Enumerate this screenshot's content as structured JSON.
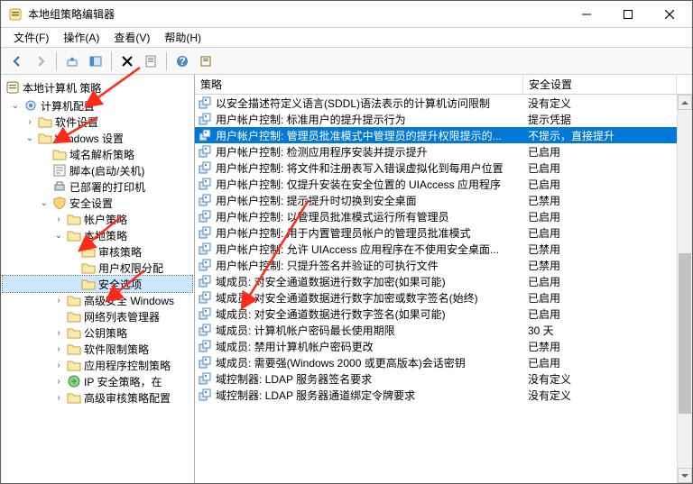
{
  "window": {
    "title": "本地组策略编辑器"
  },
  "menu": {
    "file": "文件(F)",
    "action": "操作(A)",
    "view": "查看(V)",
    "help": "帮助(H)",
    "file_u": "F",
    "action_u": "A",
    "view_u": "V",
    "help_u": "H"
  },
  "tree": {
    "header": "本地计算机 策略",
    "nodes": [
      {
        "indent": 0,
        "expand": "open",
        "icon": "gear",
        "label": "计算机配置"
      },
      {
        "indent": 1,
        "expand": "closed",
        "icon": "folder",
        "label": "软件设置"
      },
      {
        "indent": 1,
        "expand": "open",
        "icon": "folder",
        "label": "Windows 设置"
      },
      {
        "indent": 2,
        "expand": "none",
        "icon": "folder",
        "label": "域名解析策略"
      },
      {
        "indent": 2,
        "expand": "none",
        "icon": "script",
        "label": "脚本(启动/关机)"
      },
      {
        "indent": 2,
        "expand": "none",
        "icon": "printer",
        "label": "已部署的打印机"
      },
      {
        "indent": 2,
        "expand": "open",
        "icon": "shield",
        "label": "安全设置"
      },
      {
        "indent": 3,
        "expand": "closed",
        "icon": "folder",
        "label": "帐户策略"
      },
      {
        "indent": 3,
        "expand": "open",
        "icon": "folder",
        "label": "本地策略"
      },
      {
        "indent": 4,
        "expand": "none",
        "icon": "folder",
        "label": "审核策略"
      },
      {
        "indent": 4,
        "expand": "none",
        "icon": "folder",
        "label": "用户权限分配"
      },
      {
        "indent": 4,
        "expand": "none",
        "icon": "folder",
        "label": "安全选项",
        "selected": true
      },
      {
        "indent": 3,
        "expand": "closed",
        "icon": "folder",
        "label": "高级安全 Windows"
      },
      {
        "indent": 3,
        "expand": "none",
        "icon": "folder",
        "label": "网络列表管理器"
      },
      {
        "indent": 3,
        "expand": "closed",
        "icon": "folder",
        "label": "公钥策略"
      },
      {
        "indent": 3,
        "expand": "closed",
        "icon": "folder",
        "label": "软件限制策略"
      },
      {
        "indent": 3,
        "expand": "closed",
        "icon": "folder",
        "label": "应用程序控制策略"
      },
      {
        "indent": 3,
        "expand": "closed",
        "icon": "ipsec",
        "label": "IP 安全策略，在"
      },
      {
        "indent": 3,
        "expand": "closed",
        "icon": "folder",
        "label": "高级审核策略配置"
      }
    ]
  },
  "columns": {
    "name": "策略",
    "security": "安全设置"
  },
  "rows": [
    {
      "name": "以安全描述符定义语言(SDDL)语法表示的计算机访问限制",
      "sec": "没有定义"
    },
    {
      "name": "用户帐户控制: 标准用户的提升提示行为",
      "sec": "提示凭据"
    },
    {
      "name": "用户帐户控制: 管理员批准模式中管理员的提升权限提示的...",
      "sec": "不提示，直接提升",
      "selected": true
    },
    {
      "name": "用户帐户控制: 检测应用程序安装并提示提升",
      "sec": "已启用"
    },
    {
      "name": "用户帐户控制: 将文件和注册表写入错误虚拟化到每用户位置",
      "sec": "已启用"
    },
    {
      "name": "用户帐户控制: 仅提升安装在安全位置的 UIAccess 应用程序",
      "sec": "已启用"
    },
    {
      "name": "用户帐户控制: 提示提升时切换到安全桌面",
      "sec": "已禁用"
    },
    {
      "name": "用户帐户控制: 以管理员批准模式运行所有管理员",
      "sec": "已启用"
    },
    {
      "name": "用户帐户控制: 用于内置管理员帐户的管理员批准模式",
      "sec": "已启用"
    },
    {
      "name": "用户帐户控制: 允许 UIAccess 应用程序在不使用安全桌面...",
      "sec": "已禁用"
    },
    {
      "name": "用户帐户控制: 只提升签名并验证的可执行文件",
      "sec": "已禁用"
    },
    {
      "name": "域成员: 对安全通道数据进行数字加密(如果可能)",
      "sec": "已启用"
    },
    {
      "name": "域成员: 对安全通道数据进行数字加密或数字签名(始终)",
      "sec": "已启用"
    },
    {
      "name": "域成员: 对安全通道数据进行数字签名(如果可能)",
      "sec": "已启用"
    },
    {
      "name": "域成员: 计算机帐户密码最长使用期限",
      "sec": "30 天"
    },
    {
      "name": "域成员: 禁用计算机帐户密码更改",
      "sec": "已禁用"
    },
    {
      "name": "域成员: 需要强(Windows 2000 或更高版本)会话密钥",
      "sec": "已启用"
    },
    {
      "name": "域控制器: LDAP 服务器签名要求",
      "sec": "没有定义"
    },
    {
      "name": "域控制器: LDAP 服务器通道绑定令牌要求",
      "sec": "没有定义"
    }
  ]
}
